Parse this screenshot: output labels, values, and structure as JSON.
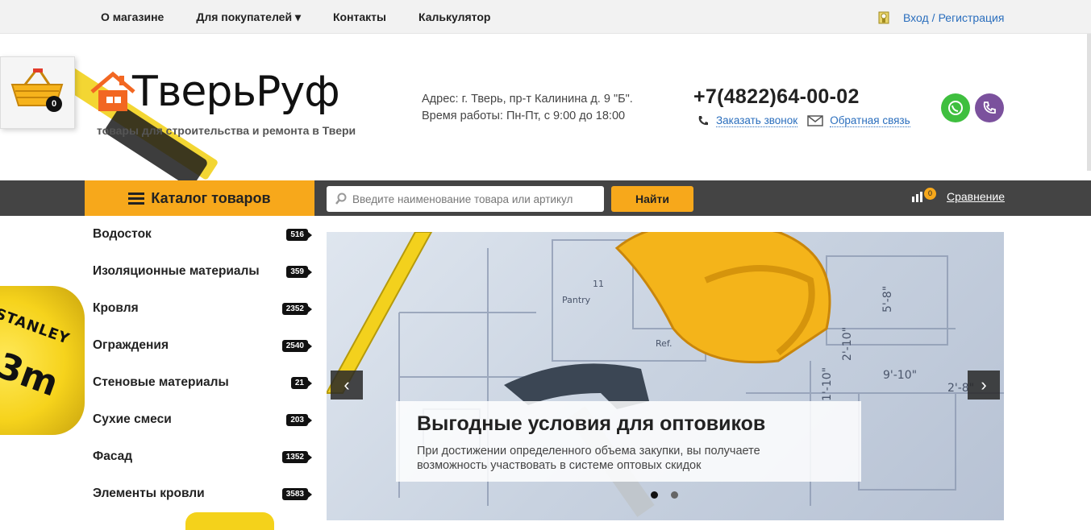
{
  "topnav": {
    "items": [
      "О магазине",
      "Для покупателей ▾",
      "Контакты",
      "Калькулятор"
    ],
    "login": "Вход",
    "separator": "/",
    "register": "Регистрация"
  },
  "cart": {
    "count": "0"
  },
  "logo": {
    "name": "ТверьРуф",
    "tagline": "товары для строительства и ремонта в Твери"
  },
  "decor": {
    "tape_brand": "STANLEY",
    "tape_size": "3m"
  },
  "contacts": {
    "address": "Адрес: г. Тверь, пр-т Калинина д. 9 \"Б\".",
    "hours": "Время работы: Пн-Пт, с 9:00 до 18:00",
    "phone": "+7(4822)64-00-02",
    "callback": "Заказать звонок",
    "feedback": "Обратная связь"
  },
  "catalog": {
    "button": "Каталог товаров"
  },
  "search": {
    "placeholder": "Введите наименование товара или артикул",
    "button": "Найти"
  },
  "compare": {
    "count": "0",
    "label": "Сравнение"
  },
  "categories": [
    {
      "name": "Водосток",
      "count": "516"
    },
    {
      "name": "Изоляционные материалы",
      "count": "359"
    },
    {
      "name": "Кровля",
      "count": "2352"
    },
    {
      "name": "Ограждения",
      "count": "2540"
    },
    {
      "name": "Стеновые материалы",
      "count": "21"
    },
    {
      "name": "Сухие смеси",
      "count": "203"
    },
    {
      "name": "Фасад",
      "count": "1352"
    },
    {
      "name": "Элементы кровли",
      "count": "3583"
    }
  ],
  "slider": {
    "title": "Выгодные условия для оптовиков",
    "text_line1": "При достижении определенного объема закупки, вы получаете",
    "text_line2": "возможность участвовать в системе оптовых скидок",
    "prev": "‹",
    "next": "›",
    "drawing_labels": [
      "Pantry",
      "Ref.",
      "9'-10\"",
      "2'-8\"",
      "2'-10\"",
      "5'-8\"",
      "1'-10\"",
      "11"
    ]
  },
  "colors": {
    "accent": "#f7a81b",
    "dark_bar": "#444444",
    "link": "#2a6ebd"
  }
}
